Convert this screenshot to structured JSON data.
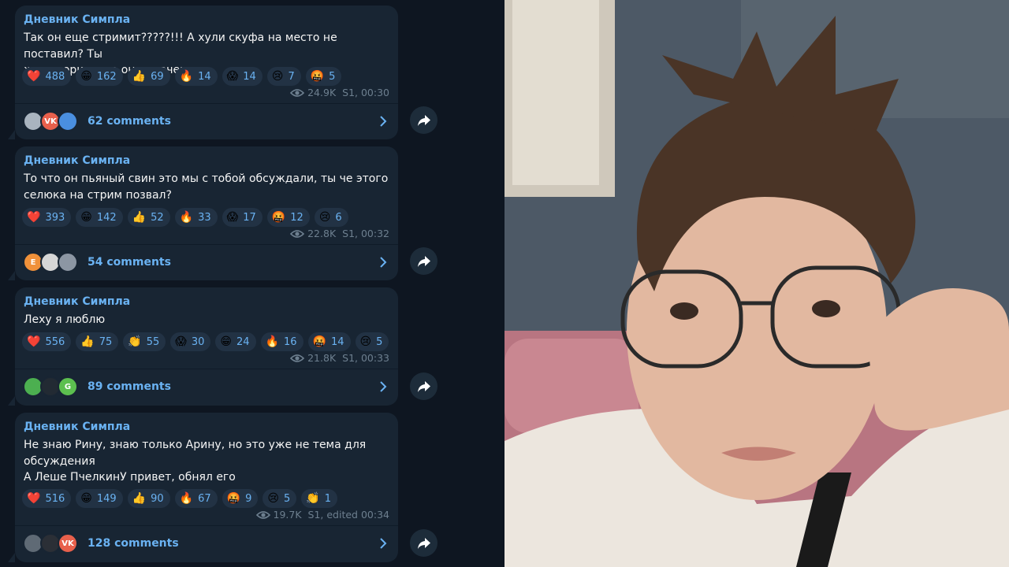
{
  "colors": {
    "background": "#0e1621",
    "bubble": "#182533",
    "accent": "#6ab2f2",
    "meta": "#6d7f8f"
  },
  "posts": [
    {
      "author": "Дневник Симпла",
      "text": "Так он еще стримит?????!!! А хули скуфа на место не поставил? Ты\nже говорил, что он дурачек",
      "reactions": [
        {
          "emoji": "❤️",
          "count": "488"
        },
        {
          "emoji": "😁",
          "count": "162"
        },
        {
          "emoji": "👍",
          "count": "69"
        },
        {
          "emoji": "🔥",
          "count": "14"
        },
        {
          "emoji": "😱",
          "count": "14"
        },
        {
          "emoji": "😢",
          "count": "7"
        },
        {
          "emoji": "🤬",
          "count": "5"
        }
      ],
      "views": "24.9K",
      "time": "S1, 00:30",
      "comments": "62 comments",
      "avatars": [
        {
          "label": "",
          "color": "#a9b4bf"
        },
        {
          "label": "VK",
          "color": "#e8604c"
        },
        {
          "label": "",
          "color": "#4a8fe0"
        }
      ]
    },
    {
      "author": "Дневник Симпла",
      "text": "То что он пьяный свин это мы с тобой обсуждали, ты че этого\nселюка на стрим позвал?",
      "reactions": [
        {
          "emoji": "❤️",
          "count": "393"
        },
        {
          "emoji": "😁",
          "count": "142"
        },
        {
          "emoji": "👍",
          "count": "52"
        },
        {
          "emoji": "🔥",
          "count": "33"
        },
        {
          "emoji": "😱",
          "count": "17"
        },
        {
          "emoji": "🤬",
          "count": "12"
        },
        {
          "emoji": "😢",
          "count": "6"
        }
      ],
      "views": "22.8K",
      "time": "S1, 00:32",
      "comments": "54 comments",
      "avatars": [
        {
          "label": "E",
          "color": "#f0913a"
        },
        {
          "label": "",
          "color": "#d6d6d6"
        },
        {
          "label": "",
          "color": "#8c96a3"
        }
      ]
    },
    {
      "author": "Дневник Симпла",
      "text": "Леху я люблю",
      "reactions": [
        {
          "emoji": "❤️",
          "count": "556"
        },
        {
          "emoji": "👍",
          "count": "75"
        },
        {
          "emoji": "👏",
          "count": "55"
        },
        {
          "emoji": "😱",
          "count": "30"
        },
        {
          "emoji": "😁",
          "count": "24"
        },
        {
          "emoji": "🔥",
          "count": "16"
        },
        {
          "emoji": "🤬",
          "count": "14"
        },
        {
          "emoji": "😢",
          "count": "5"
        }
      ],
      "views": "21.8K",
      "time": "S1, 00:33",
      "comments": "89 comments",
      "avatars": [
        {
          "label": "",
          "color": "#4caf50"
        },
        {
          "label": "",
          "color": "#222a33"
        },
        {
          "label": "G",
          "color": "#5cbf4f"
        }
      ]
    },
    {
      "author": "Дневник Симпла",
      "text": "Не знаю Рину, знаю только Арину, но это уже не тема для\nобсуждения\nА Леше ПчелкинУ привет, обнял его",
      "reactions": [
        {
          "emoji": "❤️",
          "count": "516"
        },
        {
          "emoji": "😁",
          "count": "149"
        },
        {
          "emoji": "👍",
          "count": "90"
        },
        {
          "emoji": "🔥",
          "count": "67"
        },
        {
          "emoji": "🤬",
          "count": "9"
        },
        {
          "emoji": "😢",
          "count": "5"
        },
        {
          "emoji": "👏",
          "count": "1"
        }
      ],
      "views": "19.7K",
      "time": "S1, edited 00:34",
      "comments": "128 comments",
      "avatars": [
        {
          "label": "",
          "color": "#5f6a75"
        },
        {
          "label": "",
          "color": "#2b2f36"
        },
        {
          "label": "VK",
          "color": "#e8604c"
        }
      ]
    }
  ],
  "photo": {
    "icon": "person-photo"
  }
}
